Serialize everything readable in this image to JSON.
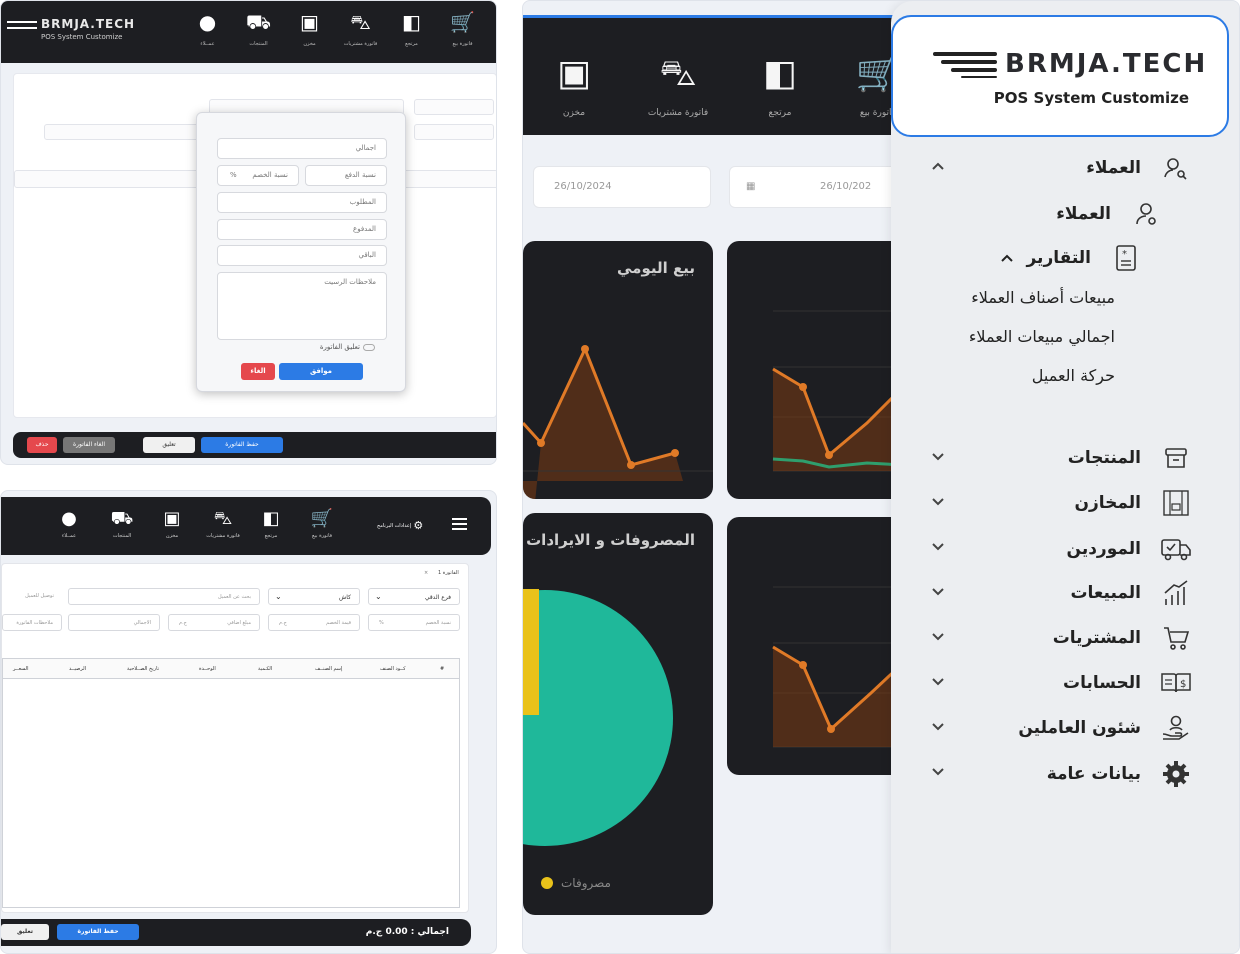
{
  "pos_window": {
    "logo_text": "BRMJA.TECH",
    "logo_sub": "POS System Customize",
    "toolbar": [
      {
        "label": "عمــلاء",
        "icon": "user-icon"
      },
      {
        "label": "المنتجات",
        "icon": "hand-truck-icon"
      },
      {
        "label": "مخزن",
        "icon": "box-icon"
      },
      {
        "label": "فاتورة مشتريات",
        "icon": "basket-icon"
      },
      {
        "label": "مرتجع",
        "icon": "return-icon"
      },
      {
        "label": "فاتورة بيع",
        "icon": "cart-icon"
      }
    ],
    "dialog": {
      "total": "اجمالي",
      "payment_ratio": "نسبة الدفع",
      "discount_ratio": "نسبة الخصم",
      "percent": "%",
      "required": "المطلوب",
      "paid": "المدفوع",
      "remaining": "الباقي",
      "receipt_notes": "ملاحظات الرسيت",
      "suspend_invoice": "تعليق الفاتورة",
      "ok": "موافق",
      "cancel": "الغاء"
    },
    "bottom_buttons": {
      "save": "حفظ الفاتورة",
      "suspend": "تعليق",
      "cancel_invoice": "الغاء الفاتورة",
      "delete": "حذف"
    },
    "colors": {
      "primary": "#2c7be5",
      "danger": "#e5484d",
      "dark": "#1d1e22"
    }
  },
  "invoice_window": {
    "settings_label": "إعدادات البرنامج",
    "tab_label": "الفاتورة 1",
    "tab_close": "×",
    "branch_select": "فرع الدقي",
    "payment_select": "كاش",
    "customer_search": "بحث عن العميل",
    "delivery_toggle": "توصيل للعميل",
    "discount_ratio": "نسبة الخصم",
    "percent": "%",
    "discount_value": "قيمة الخصم",
    "currency": "ج.م",
    "additional_amount": "مبلغ اضافي",
    "total_field": "الاجمالي",
    "invoice_notes": "ملاحظات الفاتورة",
    "columns": [
      "#",
      "كــود الصنف",
      "إسم الصنــف",
      "الكـمية",
      "الوحــدة",
      "تاريخ الصــلاحية",
      "الرصيــد",
      "السعــر"
    ],
    "save_invoice": "حفظ الفاتورة",
    "suspend": "تعليق",
    "total": "اجمالي : 0.00 ج.م"
  },
  "dashboard": {
    "brand_name": "BRMJA.TECH",
    "brand_sub": "POS System Customize",
    "top_icons": [
      {
        "label": "فاتورة بيع",
        "icon": "cart-icon"
      },
      {
        "label": "مرتجع",
        "icon": "return-icon"
      },
      {
        "label": "فاتورة مشتريات",
        "icon": "basket-icon"
      },
      {
        "label": "مخزن",
        "icon": "box-icon"
      }
    ],
    "date_from": "26/10/2024",
    "date_to": "26/10/202",
    "daily_sales_title": "بيع اليومي",
    "expenses_title": "المصروفات و الايرادات",
    "expenses_legend": "مصروفات",
    "nav": {
      "customers": "العملاء",
      "customers_sub": "العملاء",
      "reports": "التقارير",
      "report_items": [
        "مبيعات أصناف العملاء",
        "اجمالي مبيعات العملاء",
        "حركة العميل"
      ],
      "products": "المنتجات",
      "warehouses": "المخازن",
      "suppliers": "الموردين",
      "sales": "المبيعات",
      "purchases": "المشتريات",
      "accounts": "الحسابات",
      "employees": "شئون العاملين",
      "general_data": "بيانات عامة"
    }
  }
}
